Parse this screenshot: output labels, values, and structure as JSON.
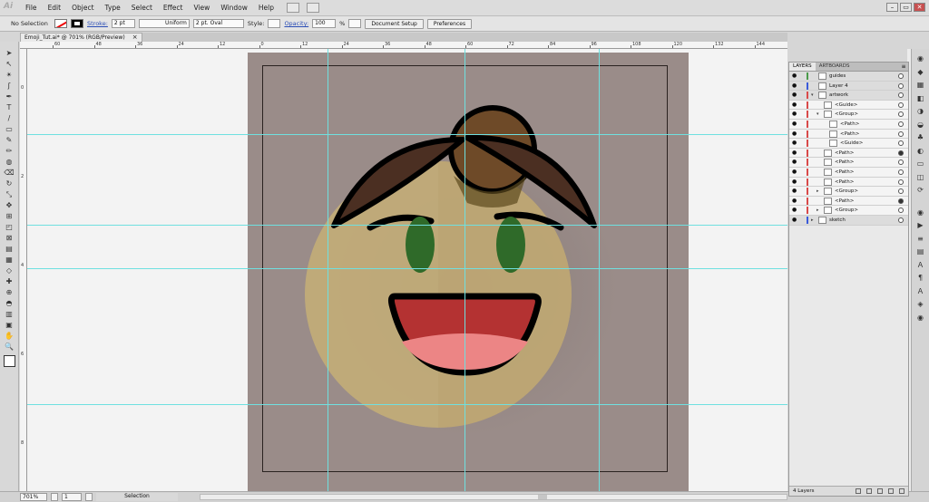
{
  "app": {
    "logo": "Ai"
  },
  "menu": [
    "File",
    "Edit",
    "Object",
    "Type",
    "Select",
    "Effect",
    "View",
    "Window",
    "Help"
  ],
  "window_controls": {
    "minimize": "–",
    "restore": "▭",
    "close": "✕"
  },
  "control_bar": {
    "selection_label": "No Selection",
    "stroke_label": "Stroke:",
    "stroke_weight": "2 pt",
    "stroke_profile": "Uniform",
    "brush": "2 pt. Oval",
    "style_label": "Style:",
    "opacity_label": "Opacity:",
    "opacity_value": "100",
    "opacity_unit": "%",
    "document_setup": "Document Setup",
    "preferences": "Preferences"
  },
  "document_tab": {
    "title": "Emoji_Tut.ai* @ 701% (RGB/Preview)",
    "close": "×"
  },
  "ruler_h": [
    "60",
    "48",
    "36",
    "24",
    "12",
    "0",
    "12",
    "24",
    "36",
    "48",
    "60",
    "72",
    "84",
    "96",
    "108",
    "120",
    "132",
    "144",
    "156",
    "168",
    "180"
  ],
  "ruler_v": [
    "0",
    "2",
    "4",
    "6",
    "8"
  ],
  "tools": [
    "➤",
    "↖",
    "✴",
    "ʃ",
    "✒",
    "T",
    "/",
    "▭",
    "✎",
    "✏",
    "◍",
    "⌫",
    "↻",
    "⤡",
    "✥",
    "⊞",
    "◰",
    "⊠",
    "▤",
    "▦",
    "◇",
    "✚",
    "⊕",
    "◓",
    "▥",
    "▣",
    "✋",
    "🔍"
  ],
  "statusbar": {
    "zoom": "701%",
    "artboard": "1",
    "status": "Selection"
  },
  "layers_panel": {
    "tabs": [
      "LAYERS",
      "ARTBOARDS"
    ],
    "menu": "≡",
    "rows": [
      {
        "name": "guides",
        "indent": 0,
        "color": "#4a9a4a",
        "target_filled": false,
        "twirl": ""
      },
      {
        "name": "Layer 4",
        "indent": 0,
        "color": "#3a5ad9",
        "target_filled": false,
        "twirl": ""
      },
      {
        "name": "artwork",
        "indent": 0,
        "color": "#d94a4a",
        "target_filled": false,
        "twirl": "▾"
      },
      {
        "name": "<Guide>",
        "indent": 1,
        "color": "#d94a4a",
        "target_filled": false,
        "twirl": ""
      },
      {
        "name": "<Group>",
        "indent": 1,
        "color": "#d94a4a",
        "target_filled": false,
        "twirl": "▾"
      },
      {
        "name": "<Path>",
        "indent": 2,
        "color": "#d94a4a",
        "target_filled": false,
        "twirl": ""
      },
      {
        "name": "<Path>",
        "indent": 2,
        "color": "#d94a4a",
        "target_filled": false,
        "twirl": ""
      },
      {
        "name": "<Guide>",
        "indent": 2,
        "color": "#d94a4a",
        "target_filled": false,
        "twirl": ""
      },
      {
        "name": "<Path>",
        "indent": 1,
        "color": "#d94a4a",
        "target_filled": true,
        "twirl": ""
      },
      {
        "name": "<Path>",
        "indent": 1,
        "color": "#d94a4a",
        "target_filled": false,
        "twirl": ""
      },
      {
        "name": "<Path>",
        "indent": 1,
        "color": "#d94a4a",
        "target_filled": false,
        "twirl": ""
      },
      {
        "name": "<Path>",
        "indent": 1,
        "color": "#d94a4a",
        "target_filled": false,
        "twirl": ""
      },
      {
        "name": "<Group>",
        "indent": 1,
        "color": "#d94a4a",
        "target_filled": false,
        "twirl": "▸"
      },
      {
        "name": "<Path>",
        "indent": 1,
        "color": "#d94a4a",
        "target_filled": true,
        "twirl": ""
      },
      {
        "name": "<Group>",
        "indent": 1,
        "color": "#d94a4a",
        "target_filled": false,
        "twirl": "▸"
      },
      {
        "name": "sketch",
        "indent": 0,
        "color": "#3a5ad9",
        "target_filled": false,
        "twirl": "▸"
      }
    ],
    "footer": "4 Layers"
  },
  "dock_icons": [
    "◉",
    "◆",
    "▦",
    "◧",
    "◑",
    "◒",
    "♣",
    "◐",
    "▭",
    "◫",
    "⟳",
    "◉",
    "▶",
    "≡",
    "▤",
    "Ａ",
    "¶",
    "Ａ",
    "◈",
    "◉"
  ],
  "colors": {
    "artboard": "#9a8c89",
    "face": "#c3ad78",
    "hair": "#4b2f22",
    "bun": "#6e4a28",
    "eyes": "#2f6a29",
    "mouth": "#b43232",
    "tongue": "#ec8585",
    "guide": "#6fe0e0"
  }
}
